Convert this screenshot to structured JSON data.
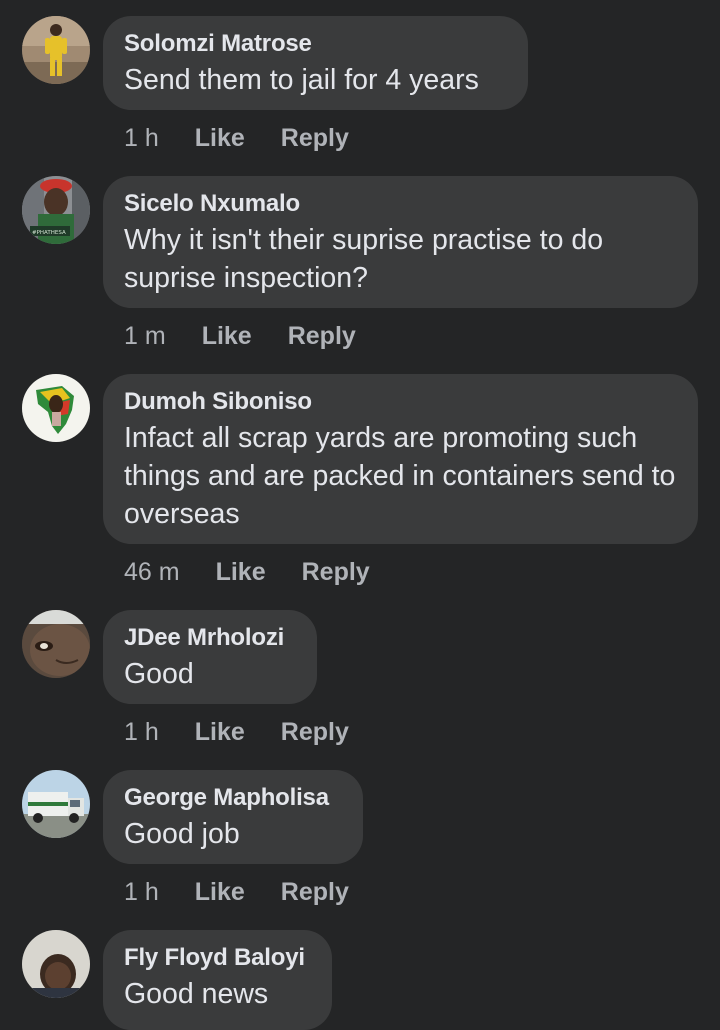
{
  "comments": [
    {
      "author": "Solomzi Matrose",
      "text": "Send them to jail for 4 years",
      "time": "1 h",
      "like": "Like",
      "reply": "Reply",
      "avatar_icon": "person-yellow-suit-avatar"
    },
    {
      "author": "Sicelo Nxumalo",
      "text": "Why it isn't their suprise practise to do suprise inspection?",
      "time": "1 m",
      "like": "Like",
      "reply": "Reply",
      "avatar_icon": "person-headdress-avatar",
      "avatar_badge": "#PHATHESA"
    },
    {
      "author": "Dumoh Siboniso",
      "text": "Infact all scrap yards are promoting such things and are packed in containers send to overseas",
      "time": "46 m",
      "like": "Like",
      "reply": "Reply",
      "avatar_icon": "africa-map-avatar"
    },
    {
      "author": "JDee Mrholozi",
      "text": "Good",
      "time": "1 h",
      "like": "Like",
      "reply": "Reply",
      "avatar_icon": "face-closeup-avatar"
    },
    {
      "author": "George Mapholisa",
      "text": "Good job",
      "time": "1 h",
      "like": "Like",
      "reply": "Reply",
      "avatar_icon": "truck-avatar"
    },
    {
      "author": "Fly Floyd Baloyi",
      "text": "Good news",
      "time": "",
      "like": "",
      "reply": "",
      "avatar_icon": "person-portrait-avatar"
    }
  ],
  "colors": {
    "background": "#242526",
    "bubble": "#3a3b3c",
    "text": "#e4e6eb",
    "secondary": "#b0b3b8"
  }
}
